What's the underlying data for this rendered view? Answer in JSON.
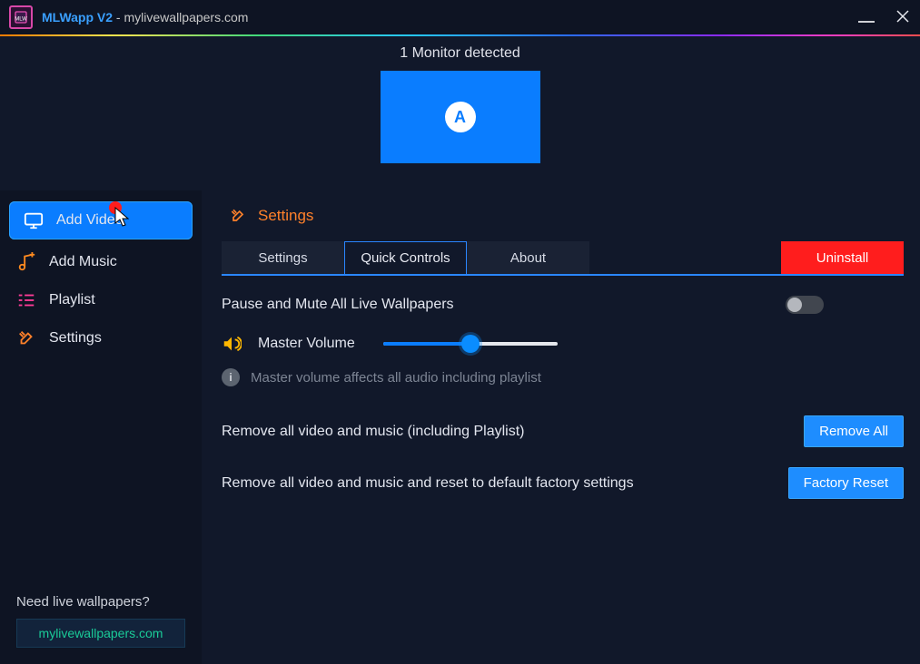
{
  "titlebar": {
    "app_name": "MLWapp V2",
    "separator": " - ",
    "site": "mylivewallpapers.com"
  },
  "monitor": {
    "status": "1 Monitor detected",
    "label": "A"
  },
  "sidebar": {
    "items": [
      {
        "label": "Add Video",
        "icon": "monitor-icon",
        "active": true
      },
      {
        "label": "Add Music",
        "icon": "music-plus-icon",
        "active": false
      },
      {
        "label": "Playlist",
        "icon": "playlist-icon",
        "active": false
      },
      {
        "label": "Settings",
        "icon": "tools-icon",
        "active": false
      }
    ],
    "footer_prompt": "Need live wallpapers?",
    "footer_link": "mylivewallpapers.com"
  },
  "content": {
    "header_icon": "tools-icon",
    "header_title": "Settings",
    "tabs": [
      {
        "label": "Settings",
        "active": false
      },
      {
        "label": "Quick Controls",
        "active": true
      },
      {
        "label": "About",
        "active": false
      }
    ],
    "uninstall": "Uninstall",
    "pause_mute_label": "Pause and Mute All Live Wallpapers",
    "pause_mute_on": false,
    "master_volume_label": "Master Volume",
    "master_volume_pct": 50,
    "master_volume_help": "Master volume affects all audio including playlist",
    "remove_all_label": "Remove all video and music (including Playlist)",
    "remove_all_btn": "Remove All",
    "factory_reset_label": "Remove all video and music and reset to default factory settings",
    "factory_reset_btn": "Factory Reset"
  },
  "colors": {
    "accent_blue": "#0a7dff",
    "accent_orange": "#ff812a",
    "danger": "#ff1d1d",
    "link_green": "#1acb98"
  }
}
